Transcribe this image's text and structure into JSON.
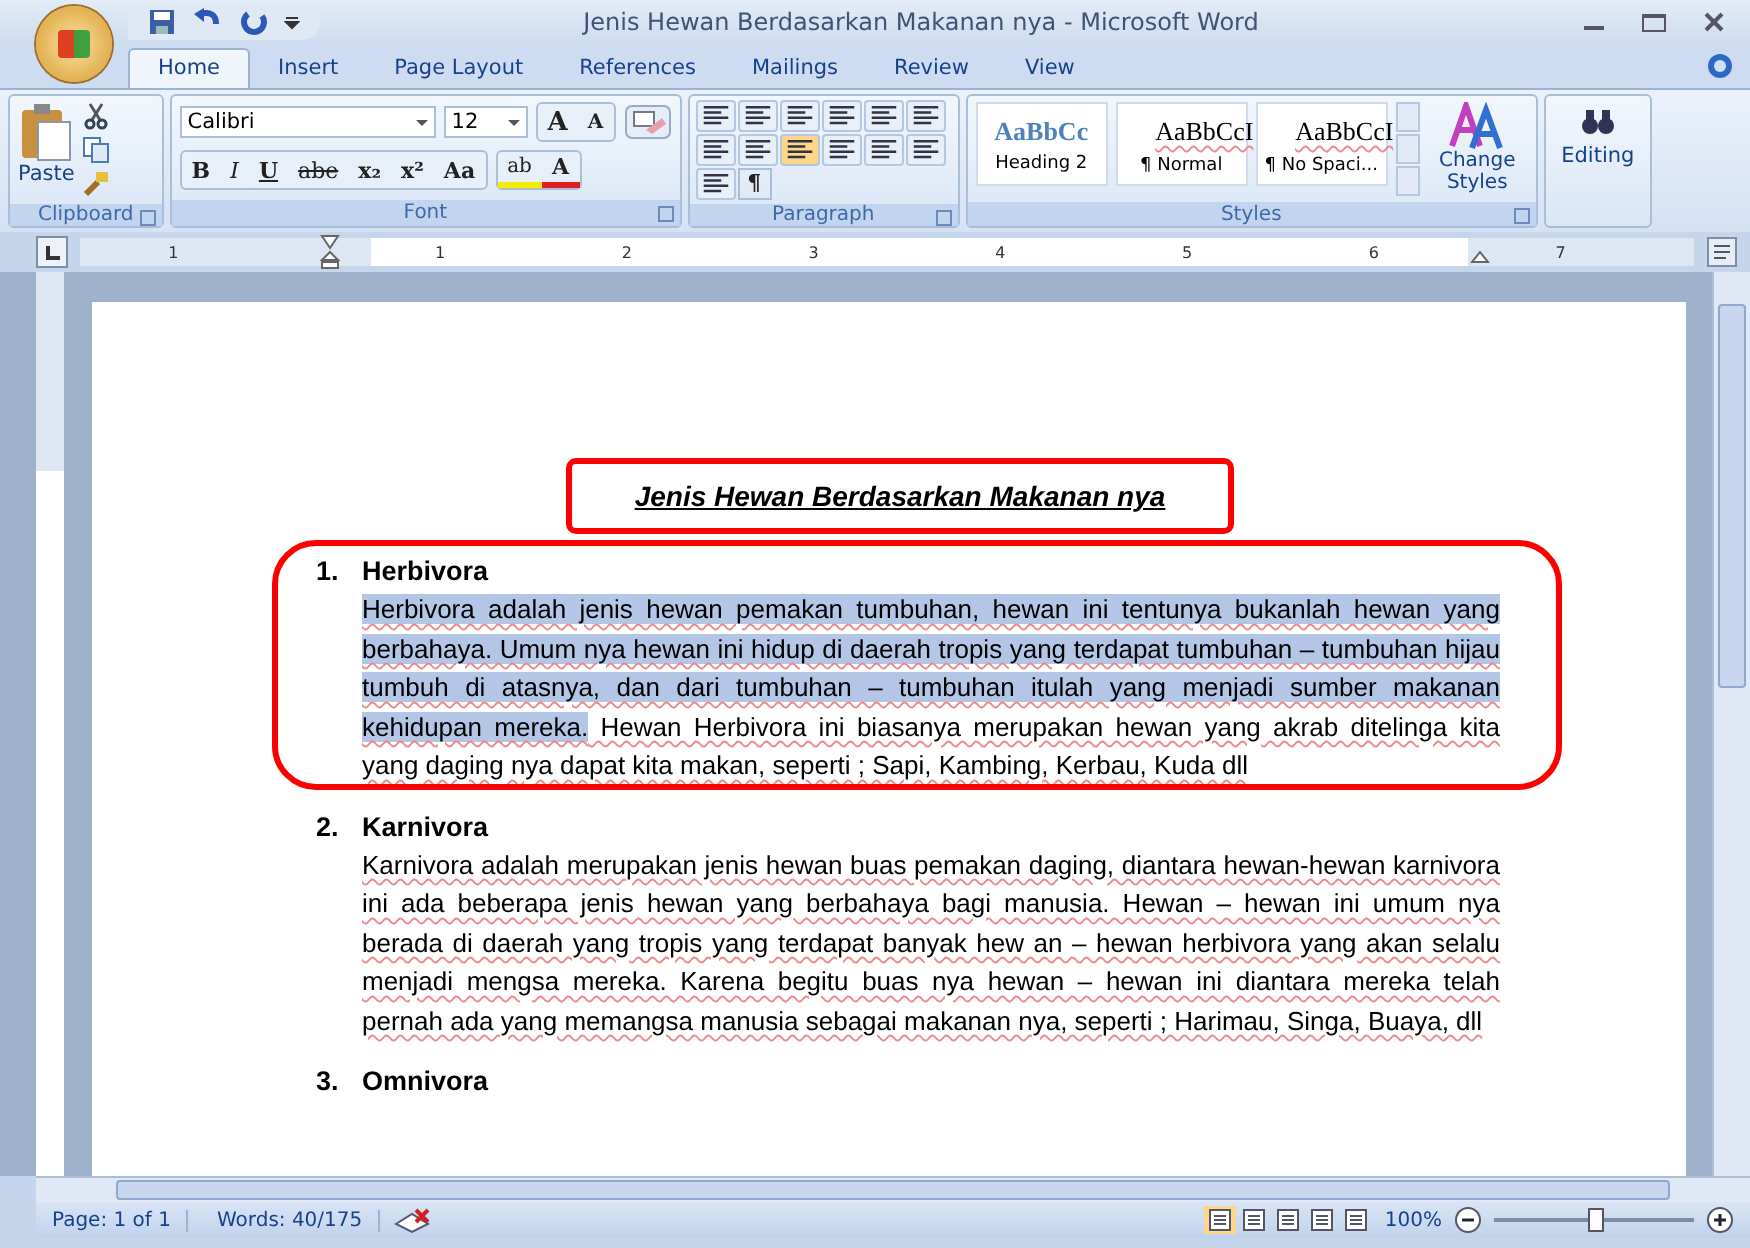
{
  "window": {
    "title": "Jenis Hewan Berdasarkan Makanan nya - Microsoft Word"
  },
  "tabs": [
    {
      "label": "Home",
      "selected": true
    },
    {
      "label": "Insert",
      "selected": false
    },
    {
      "label": "Page Layout",
      "selected": false
    },
    {
      "label": "References",
      "selected": false
    },
    {
      "label": "Mailings",
      "selected": false
    },
    {
      "label": "Review",
      "selected": false
    },
    {
      "label": "View",
      "selected": false
    }
  ],
  "clipboard": {
    "paste": "Paste",
    "group": "Clipboard"
  },
  "font": {
    "name": "Calibri",
    "size": "12",
    "group": "Font",
    "grow": "A",
    "shrink": "A",
    "color_button": "A",
    "highlight": "ab",
    "buttons": [
      {
        "label": "B",
        "kind": "bold"
      },
      {
        "label": "I",
        "kind": "italic"
      },
      {
        "label": "U",
        "kind": "underline"
      },
      {
        "label": "abe",
        "kind": "strike"
      },
      {
        "label": "x₂",
        "kind": "plain"
      },
      {
        "label": "x²",
        "kind": "plain"
      },
      {
        "label": "Aa",
        "kind": "plain"
      }
    ]
  },
  "paragraph": {
    "group": "Paragraph",
    "pilcrow": "¶"
  },
  "styles": {
    "group": "Styles",
    "items": [
      {
        "sample": "AaBbCc",
        "name": "Heading 2",
        "kind": "heading"
      },
      {
        "sample": "AaBbCcI",
        "name": "¶ Normal",
        "kind": "body"
      },
      {
        "sample": "AaBbCcI",
        "name": "¶ No Spaci...",
        "kind": "body"
      }
    ],
    "change": "Change Styles"
  },
  "editing": {
    "label": "Editing"
  },
  "ruler": [
    "1",
    "1",
    "2",
    "3",
    "4",
    "5",
    "6",
    "7"
  ],
  "document": {
    "title": "Jenis Hewan Berdasarkan Makanan nya",
    "sections": [
      {
        "number": "1.",
        "heading": "Herbivora",
        "text": [
          {
            "text": "Herbivora adalah jenis hewan pemakan tumbuhan, hewan ini tentunya bukanlah hewan yang berbahaya. Umum nya hewan ini hidup di daerah tropis yang terdapat tumbuhan – tumbuhan hijau tumbuh di atasnya, dan dari tumbuhan – tumbuhan itulah yang menjadi sumber makanan kehidupan mereka.",
            "selected": true
          },
          {
            "text": " Hewan Herbivora ini biasanya merupakan hewan yang akrab ditelinga kita yang daging nya dapat kita makan, seperti ; Sapi, Kambing, Kerbau, Kuda dll",
            "selected": false
          }
        ]
      },
      {
        "number": "2.",
        "heading": "Karnivora",
        "text": [
          {
            "text": "Karnivora adalah merupakan jenis hewan buas pemakan daging, diantara hewan-hewan karnivora ini ada beberapa jenis hewan yang berbahaya bagi manusia. Hewan – hewan ini umum nya berada di daerah yang tropis yang terdapat banyak hew an – hewan herbivora yang akan selalu menjadi mengsa mereka. Karena begitu buas nya hewan – hewan ini diantara mereka telah pernah ada yang memangsa manusia sebagai makanan nya, seperti ; Harimau, Singa, Buaya, dll",
            "selected": false
          }
        ]
      },
      {
        "number": "3.",
        "heading": "Omnivora"
      }
    ]
  },
  "status_bar": {
    "page": "Page: 1 of 1",
    "words": "Words: 40/175",
    "zoom": "100%",
    "level": 0.5
  }
}
